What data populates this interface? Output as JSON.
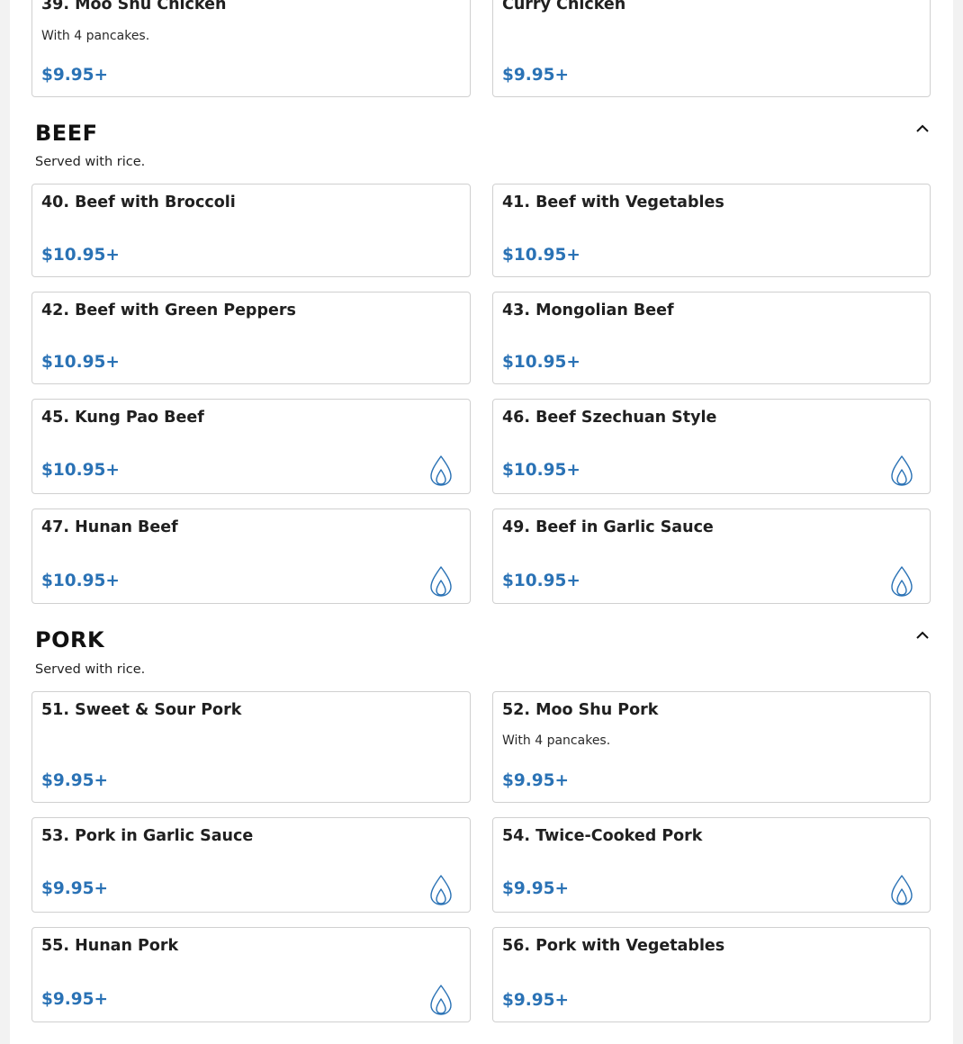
{
  "colors": {
    "price": "#2a72b5",
    "flame": "#2a72b5",
    "border": "#d0d0d0"
  },
  "top_items": [
    {
      "name": "39. Moo Shu Chicken",
      "description": "With 4 pancakes.",
      "price": "$9.95+",
      "spicy": false
    },
    {
      "name": "Curry Chicken",
      "description": "",
      "price": "$9.95+",
      "spicy": false
    }
  ],
  "sections": [
    {
      "title": "BEEF",
      "subtitle": "Served with rice.",
      "toggle_icon": "chevron-up-icon",
      "items": [
        {
          "name": "40. Beef with Broccoli",
          "price": "$10.95+",
          "spicy": false
        },
        {
          "name": "41. Beef with Vegetables",
          "price": "$10.95+",
          "spicy": false
        },
        {
          "name": "42. Beef with Green Peppers",
          "price": "$10.95+",
          "spicy": false
        },
        {
          "name": "43. Mongolian Beef",
          "price": "$10.95+",
          "spicy": false
        },
        {
          "name": "45. Kung Pao Beef",
          "price": "$10.95+",
          "spicy": true
        },
        {
          "name": "46. Beef Szechuan Style",
          "price": "$10.95+",
          "spicy": true
        },
        {
          "name": "47. Hunan Beef",
          "price": "$10.95+",
          "spicy": true
        },
        {
          "name": "49. Beef in Garlic Sauce",
          "price": "$10.95+",
          "spicy": true
        }
      ]
    },
    {
      "title": "PORK",
      "subtitle": "Served with rice.",
      "toggle_icon": "chevron-up-icon",
      "items": [
        {
          "name": "51. Sweet & Sour Pork",
          "description": "",
          "price": "$9.95+",
          "spicy": false
        },
        {
          "name": "52. Moo Shu Pork",
          "description": "With 4 pancakes.",
          "price": "$9.95+",
          "spicy": false
        },
        {
          "name": "53. Pork in Garlic Sauce",
          "price": "$9.95+",
          "spicy": true
        },
        {
          "name": "54. Twice-Cooked Pork",
          "price": "$9.95+",
          "spicy": true
        },
        {
          "name": "55. Hunan Pork",
          "price": "$9.95+",
          "spicy": true
        },
        {
          "name": "56. Pork with Vegetables",
          "price": "$9.95+",
          "spicy": false
        }
      ]
    }
  ]
}
